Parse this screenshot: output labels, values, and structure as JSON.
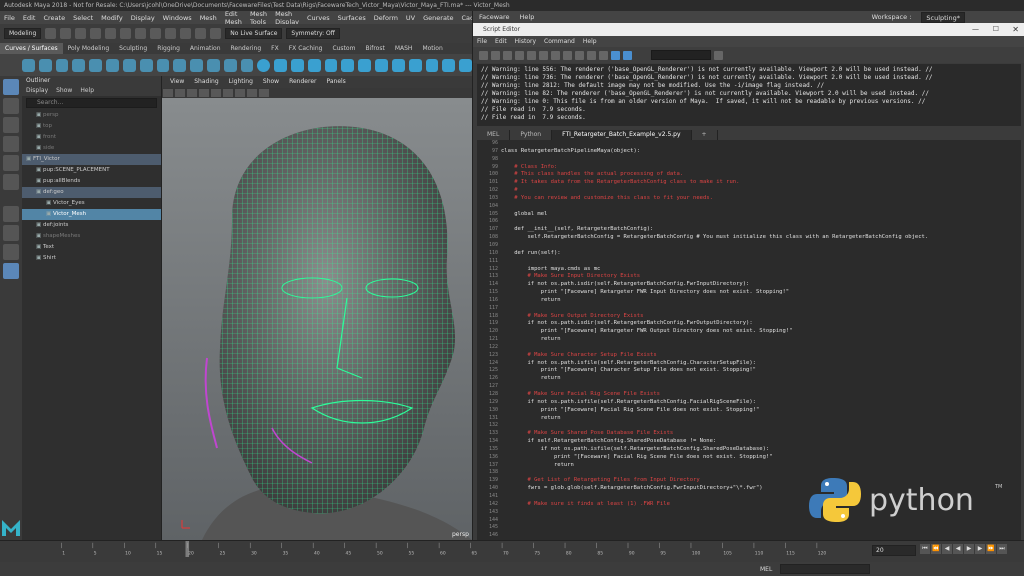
{
  "window": {
    "title": "Autodesk Maya 2018 - Not for Resale: C:\\Users\\jcohl\\OneDrive\\Documents\\FacewareFiles\\Test Data\\Rigs\\FacewareTech_Victor_Maya\\Victor_Maya_FTI.ma* --- Victor_Mesh"
  },
  "menubar": {
    "items": [
      "File",
      "Edit",
      "Create",
      "Select",
      "Modify",
      "Display",
      "Windows",
      "Mesh",
      "Edit Mesh",
      "Mesh Tools",
      "Mesh Display",
      "Curves",
      "Surfaces",
      "Deform",
      "UV",
      "Generate",
      "Cache"
    ],
    "faceware_items": [
      "Faceware",
      "Help"
    ],
    "workspace_label": "Workspace :",
    "workspace_value": "Sculpting*"
  },
  "statusline": {
    "mode": "Modeling",
    "live_surface": "No Live Surface",
    "symmetry": "Symmetry: Off"
  },
  "shelf_tabs": [
    "Curves / Surfaces",
    "Poly Modeling",
    "Sculpting",
    "Rigging",
    "Animation",
    "Rendering",
    "FX",
    "FX Caching",
    "Custom",
    "Bifrost",
    "MASH",
    "Motion"
  ],
  "outliner": {
    "title": "Outliner",
    "menu": [
      "Display",
      "Show",
      "Help"
    ],
    "search_placeholder": "Search...",
    "rows": [
      {
        "label": "persp",
        "dim": true,
        "indent": 1
      },
      {
        "label": "top",
        "dim": true,
        "indent": 1
      },
      {
        "label": "front",
        "dim": true,
        "indent": 1
      },
      {
        "label": "side",
        "dim": true,
        "indent": 1
      },
      {
        "label": "FTI_Victor",
        "dim": false,
        "indent": 0,
        "state": "hl"
      },
      {
        "label": "pup:SCENE_PLACEMENT",
        "dim": false,
        "indent": 1
      },
      {
        "label": "pup:allBlends",
        "dim": false,
        "indent": 1
      },
      {
        "label": "def:geo",
        "dim": false,
        "indent": 1,
        "state": "hl"
      },
      {
        "label": "Victor_Eyes",
        "dim": false,
        "indent": 2
      },
      {
        "label": "Victor_Mesh",
        "dim": false,
        "indent": 2,
        "state": "sel"
      },
      {
        "label": "def:joints",
        "dim": false,
        "indent": 1
      },
      {
        "label": "shapeMeshes",
        "dim": true,
        "indent": 1
      },
      {
        "label": "Text",
        "dim": false,
        "indent": 1
      },
      {
        "label": "Shirt",
        "dim": false,
        "indent": 1
      }
    ]
  },
  "viewport": {
    "menu": [
      "View",
      "Shading",
      "Lighting",
      "Show",
      "Renderer",
      "Panels"
    ],
    "camera_label": "persp"
  },
  "script_editor": {
    "title": "Script Editor",
    "menu": [
      "File",
      "Edit",
      "History",
      "Command",
      "Help"
    ],
    "history": [
      "// Warning: line 556: The renderer ('base_OpenGL_Renderer') is not currently available. Viewport 2.0 will be used instead. //",
      "// Warning: line 736: The renderer ('base_OpenGL_Renderer') is not currently available. Viewport 2.0 will be used instead. //",
      "// Warning: line 2812: The default image may not be modified. Use the -i/image flag instead. //",
      "// Warning: line 82: The renderer ('base_OpenGL_Renderer') is not currently available. Viewport 2.0 will be used instead. //",
      "// Warning: line 0: This file is from an older version of Maya.  If saved, it will not be readable by previous versions. //",
      "// File read in  7.9 seconds.",
      "// File read in  7.9 seconds."
    ],
    "tabs": [
      "MEL",
      "Python",
      "FTI_Retargeter_Batch_Example_v2.5.py",
      "+"
    ],
    "line_numbers": [
      96,
      97,
      98,
      99,
      100,
      101,
      102,
      103,
      104,
      105,
      106,
      107,
      108,
      109,
      110,
      111,
      112,
      113,
      114,
      115,
      116,
      117,
      118,
      119,
      120,
      121,
      122,
      123,
      124,
      125,
      126,
      127,
      128,
      129,
      130,
      131,
      132,
      133,
      134,
      135,
      136,
      137,
      138,
      139,
      140,
      141,
      142,
      143,
      144,
      145,
      146,
      147
    ],
    "code": [
      {
        "t": "",
        "c": "n"
      },
      {
        "t": "class RetargeterBatchPipelineMaya(object):",
        "c": "n"
      },
      {
        "t": "",
        "c": "n"
      },
      {
        "t": "    # Class Info:",
        "c": "cm"
      },
      {
        "t": "    # This class handles the actual processing of data.",
        "c": "cm"
      },
      {
        "t": "    # It takes data from the RetargeterBatchConfig class to make it run.",
        "c": "cm"
      },
      {
        "t": "    #",
        "c": "cm"
      },
      {
        "t": "    # You can review and customize this class to fit your needs.",
        "c": "cm"
      },
      {
        "t": "",
        "c": "n"
      },
      {
        "t": "    global mel",
        "c": "kw"
      },
      {
        "t": "",
        "c": "n"
      },
      {
        "t": "    def __init__(self, RetargeterBatchConfig):",
        "c": "n"
      },
      {
        "t": "        self.RetargeterBatchConfig = RetargeterBatchConfig # You must initialize this class with an RetargeterBatchConfig object.",
        "c": "mix"
      },
      {
        "t": "",
        "c": "n"
      },
      {
        "t": "    def run(self):",
        "c": "n"
      },
      {
        "t": "",
        "c": "n"
      },
      {
        "t": "        import maya.cmds as mc",
        "c": "n"
      },
      {
        "t": "        # Make Sure Input Directory Exists",
        "c": "cm"
      },
      {
        "t": "        if not os.path.isdir(self.RetargeterBatchConfig.FwrInputDirectory):",
        "c": "n"
      },
      {
        "t": "            print \"[Faceware] Retargeter FWR Input Directory does not exist. Stopping!\"",
        "c": "n"
      },
      {
        "t": "            return",
        "c": "n"
      },
      {
        "t": "",
        "c": "n"
      },
      {
        "t": "        # Make Sure Output Directory Exists",
        "c": "cm"
      },
      {
        "t": "        if not os.path.isdir(self.RetargeterBatchConfig.FwrOutputDirectory):",
        "c": "n"
      },
      {
        "t": "            print \"[Faceware] Retargeter FWR Output Directory does not exist. Stopping!\"",
        "c": "n"
      },
      {
        "t": "            return",
        "c": "n"
      },
      {
        "t": "",
        "c": "n"
      },
      {
        "t": "        # Make Sure Character Setup File Exists",
        "c": "cm"
      },
      {
        "t": "        if not os.path.isfile(self.RetargeterBatchConfig.CharacterSetupFile):",
        "c": "n"
      },
      {
        "t": "            print \"[Faceware] Character Setup File does not exist. Stopping!\"",
        "c": "n"
      },
      {
        "t": "            return",
        "c": "n"
      },
      {
        "t": "",
        "c": "n"
      },
      {
        "t": "        # Make Sure Facial Rig Scene File Exists",
        "c": "cm"
      },
      {
        "t": "        if not os.path.isfile(self.RetargeterBatchConfig.FacialRigSceneFile):",
        "c": "n"
      },
      {
        "t": "            print \"[Faceware] Facial Rig Scene File does not exist. Stopping!\"",
        "c": "n"
      },
      {
        "t": "            return",
        "c": "n"
      },
      {
        "t": "",
        "c": "n"
      },
      {
        "t": "        # Make Sure Shared Pose Database File Exists",
        "c": "cm"
      },
      {
        "t": "        if self.RetargeterBatchConfig.SharedPoseDatabase != None:",
        "c": "n"
      },
      {
        "t": "            if not os.path.isfile(self.RetargeterBatchConfig.SharedPoseDatabase):",
        "c": "n"
      },
      {
        "t": "                print \"[Faceware] Facial Rig Scene File does not exist. Stopping!\"",
        "c": "n"
      },
      {
        "t": "                return",
        "c": "n"
      },
      {
        "t": "",
        "c": "n"
      },
      {
        "t": "        # Get List of Retargeting Files from Input Directory",
        "c": "cm"
      },
      {
        "t": "        fwrs = glob.glob(self.RetargeterBatchConfig.FwrInputDirectory+\"\\*.fwr\")",
        "c": "n"
      },
      {
        "t": "",
        "c": "n"
      },
      {
        "t": "        # Make sure it finds at least (1) .FWR File",
        "c": "cm"
      }
    ]
  },
  "python_logo": {
    "text": "python",
    "tm": "TM"
  },
  "timeline": {
    "ticks": [
      "1",
      "5",
      "10",
      "15",
      "20",
      "25",
      "30",
      "35",
      "40",
      "45",
      "50",
      "55",
      "60",
      "65",
      "70",
      "75",
      "80",
      "85",
      "90",
      "95",
      "100",
      "105",
      "110",
      "115",
      "120"
    ],
    "current_frame": "20",
    "frame_field": "20"
  },
  "command_line": {
    "mel_label": "MEL"
  },
  "colors": {
    "accent": "#5285a6",
    "wire": "#2dfc9a",
    "comment": "#dd4444"
  }
}
